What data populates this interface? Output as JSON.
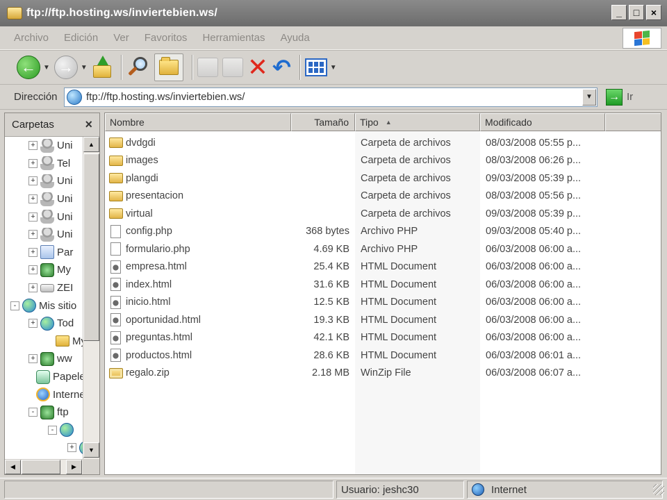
{
  "window": {
    "title": "ftp://ftp.hosting.ws/inviertebien.ws/",
    "min_icon": "_",
    "max_icon": "□",
    "close_icon": "×"
  },
  "menu": [
    "Archivo",
    "Edición",
    "Ver",
    "Favoritos",
    "Herramientas",
    "Ayuda"
  ],
  "toolbar": {
    "icons": [
      "back-icon",
      "forward-icon",
      "up-folder-icon",
      "search-icon",
      "folders-icon",
      "move-to-icon",
      "copy-to-icon",
      "delete-icon",
      "undo-icon",
      "views-icon"
    ]
  },
  "address": {
    "label": "Dirección",
    "value": "ftp://ftp.hosting.ws/inviertebien.ws/",
    "go_label": "Ir"
  },
  "folders_pane": {
    "title": "Carpetas",
    "close": "×",
    "items": [
      {
        "label": "Uni",
        "expander": "+",
        "icon": "user"
      },
      {
        "label": "Tel",
        "expander": "+",
        "icon": "user"
      },
      {
        "label": "Uni",
        "expander": "+",
        "icon": "user"
      },
      {
        "label": "Uni",
        "expander": "+",
        "icon": "user"
      },
      {
        "label": "Uni",
        "expander": "+",
        "icon": "user"
      },
      {
        "label": "Uni",
        "expander": "+",
        "icon": "user"
      },
      {
        "label": "Par",
        "expander": "+",
        "icon": "doc"
      },
      {
        "label": "My",
        "expander": "+",
        "icon": "net"
      },
      {
        "label": "ZEI",
        "expander": "+",
        "icon": "drive"
      },
      {
        "label": "Mis sitio",
        "expander": "-",
        "icon": "globe"
      },
      {
        "label": "Tod",
        "expander": "+",
        "icon": "globe"
      },
      {
        "label": "My",
        "expander": "",
        "icon": "folder"
      },
      {
        "label": "ww",
        "expander": "+",
        "icon": "net"
      },
      {
        "label": "Papeler",
        "expander": "",
        "icon": "bin"
      },
      {
        "label": "Interne",
        "expander": "",
        "icon": "ie"
      },
      {
        "label": "ftp",
        "expander": "-",
        "icon": "net"
      },
      {
        "label": "",
        "expander": "-",
        "icon": "globe"
      },
      {
        "label": "",
        "expander": "+",
        "icon": "globe"
      }
    ]
  },
  "file_list": {
    "columns": {
      "name": "Nombre",
      "size": "Tamaño",
      "type": "Tipo",
      "modified": "Modificado",
      "sort_arrow": "▲"
    },
    "rows": [
      {
        "name": "dvdgdi",
        "size": "",
        "type": "Carpeta de archivos",
        "modified": "08/03/2008 05:55 p...",
        "kind": "folder"
      },
      {
        "name": "images",
        "size": "",
        "type": "Carpeta de archivos",
        "modified": "08/03/2008 06:26 p...",
        "kind": "folder"
      },
      {
        "name": "plangdi",
        "size": "",
        "type": "Carpeta de archivos",
        "modified": "09/03/2008 05:39 p...",
        "kind": "folder"
      },
      {
        "name": "presentacion",
        "size": "",
        "type": "Carpeta de archivos",
        "modified": "08/03/2008 05:56 p...",
        "kind": "folder"
      },
      {
        "name": "virtual",
        "size": "",
        "type": "Carpeta de archivos",
        "modified": "09/03/2008 05:39 p...",
        "kind": "folder"
      },
      {
        "name": "config.php",
        "size": "368 bytes",
        "type": "Archivo PHP",
        "modified": "09/03/2008 05:40 p...",
        "kind": "php"
      },
      {
        "name": "formulario.php",
        "size": "4.69 KB",
        "type": "Archivo PHP",
        "modified": "06/03/2008 06:00 a...",
        "kind": "php"
      },
      {
        "name": "empresa.html",
        "size": "25.4 KB",
        "type": "HTML Document",
        "modified": "06/03/2008 06:00 a...",
        "kind": "html"
      },
      {
        "name": "index.html",
        "size": "31.6 KB",
        "type": "HTML Document",
        "modified": "06/03/2008 06:00 a...",
        "kind": "html"
      },
      {
        "name": "inicio.html",
        "size": "12.5 KB",
        "type": "HTML Document",
        "modified": "06/03/2008 06:00 a...",
        "kind": "html"
      },
      {
        "name": "oportunidad.html",
        "size": "19.3 KB",
        "type": "HTML Document",
        "modified": "06/03/2008 06:00 a...",
        "kind": "html"
      },
      {
        "name": "preguntas.html",
        "size": "42.1 KB",
        "type": "HTML Document",
        "modified": "06/03/2008 06:00 a...",
        "kind": "html"
      },
      {
        "name": "productos.html",
        "size": "28.6 KB",
        "type": "HTML Document",
        "modified": "06/03/2008 06:01 a...",
        "kind": "html"
      },
      {
        "name": "regalo.zip",
        "size": "2.18 MB",
        "type": "WinZip File",
        "modified": "06/03/2008 06:07 a...",
        "kind": "zip"
      }
    ]
  },
  "status": {
    "user": "Usuario: jeshc30",
    "zone": "Internet"
  }
}
